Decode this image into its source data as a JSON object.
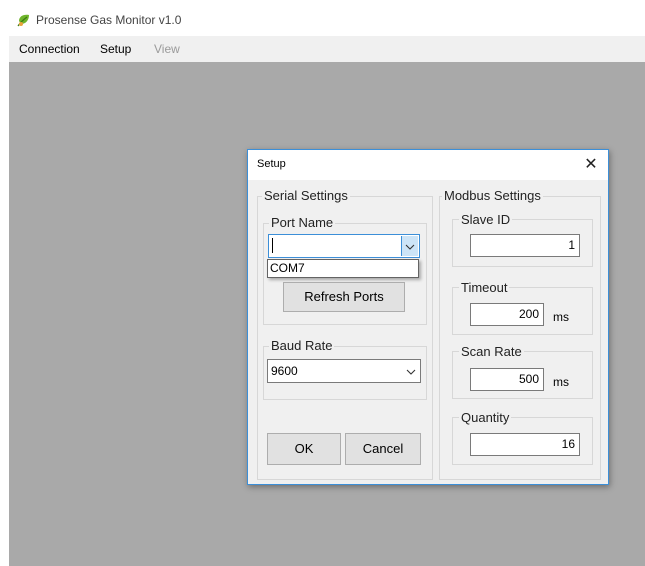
{
  "app": {
    "title": "Prosense Gas Monitor v1.0",
    "icon": "leaf-logo-icon"
  },
  "menu": {
    "items": [
      {
        "label": "Connection",
        "enabled": true
      },
      {
        "label": "Setup",
        "enabled": true
      },
      {
        "label": "View",
        "enabled": false
      }
    ]
  },
  "dialog": {
    "title": "Setup",
    "close_glyph": "✕",
    "serial": {
      "group_label": "Serial Settings",
      "port": {
        "label": "Port Name",
        "value": "",
        "options": [
          "COM7"
        ],
        "refresh_label": "Refresh Ports"
      },
      "baud": {
        "label": "Baud Rate",
        "value": "9600"
      }
    },
    "modbus": {
      "group_label": "Modbus Settings",
      "slave_id": {
        "label": "Slave ID",
        "value": "1"
      },
      "timeout": {
        "label": "Timeout",
        "value": "200",
        "unit": "ms"
      },
      "scan_rate": {
        "label": "Scan Rate",
        "value": "500",
        "unit": "ms"
      },
      "quantity": {
        "label": "Quantity",
        "value": "16"
      }
    },
    "ok_label": "OK",
    "cancel_label": "Cancel"
  },
  "colors": {
    "accent": "#3c8fd8",
    "workspace": "#a9a9a9",
    "dialog_bg": "#f0f0f0"
  }
}
